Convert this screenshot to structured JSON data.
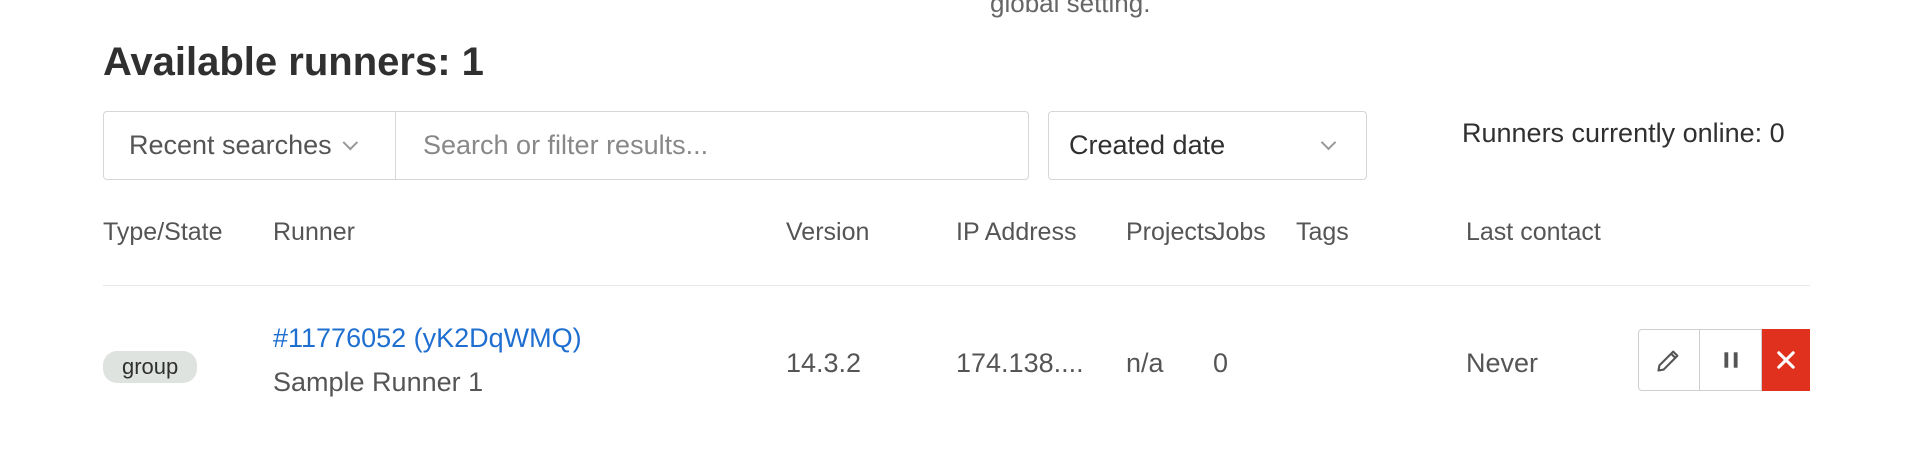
{
  "top_fragment": "global setting.",
  "heading": "Available runners: 1",
  "filter": {
    "recent_searches_label": "Recent searches",
    "search_placeholder": "Search or filter results...",
    "sort_selected": "Created date"
  },
  "online_status": "Runners currently online: 0",
  "table": {
    "columns": [
      "Type/State",
      "Runner",
      "Version",
      "IP Address",
      "Projects",
      "Jobs",
      "Tags",
      "Last contact"
    ],
    "rows": [
      {
        "type_badge": "group",
        "runner_id": "#11776052 (yK2DqWMQ)",
        "runner_description": "Sample Runner 1",
        "version": "14.3.2",
        "ip_address": "174.138....",
        "projects": "n/a",
        "jobs": "0",
        "tags": "",
        "last_contact": "Never"
      }
    ]
  },
  "icons": {
    "edit": "pencil-icon",
    "pause": "pause-icon",
    "remove": "close-icon"
  },
  "colors": {
    "link": "#1f6fd1",
    "danger": "#e0301e",
    "badge_bg": "#dfe3df",
    "border": "#d6d6d6"
  }
}
